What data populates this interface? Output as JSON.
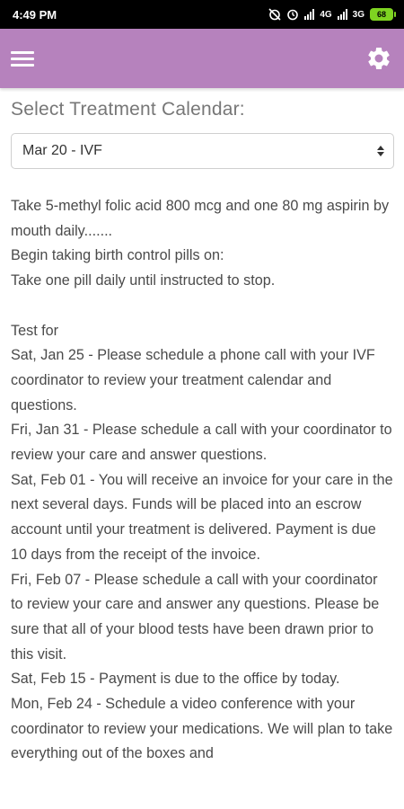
{
  "status": {
    "time": "4:49 PM",
    "network1": "4G",
    "network2": "3G",
    "battery": "68"
  },
  "appbar": {
    "menu_icon": "hamburger-menu-icon",
    "settings_icon": "gear-icon",
    "color": "#b682bd"
  },
  "page": {
    "select_label": "Select Treatment Calendar:",
    "selected_calendar": "Mar 20 - IVF",
    "intro_lines": [
      "Take 5-methyl folic acid 800 mcg and one 80 mg aspirin by mouth daily.......",
      "Begin taking birth control pills on:",
      "Take one pill daily until instructed to stop."
    ],
    "schedule_lines": [
      "Test for",
      "Sat, Jan 25 - Please schedule a phone call with your IVF coordinator to review your treatment calendar and questions.",
      "Fri, Jan 31 - Please schedule a call with your coordinator to review your care and answer questions.",
      "Sat, Feb 01 - You will receive an invoice for your care in the next several days. Funds will be placed into an escrow account until your treatment is delivered. Payment is due 10 days from the receipt of the invoice.",
      "Fri, Feb 07 - Please schedule a call with your coordinator to review your care and answer any questions. Please be sure that all of your blood tests have been drawn prior to this visit.",
      "Sat, Feb 15 - Payment is due to the office by today.",
      "Mon, Feb 24 - Schedule a video conference with your coordinator to review your medications. We will plan to take everything out of the boxes and"
    ]
  }
}
